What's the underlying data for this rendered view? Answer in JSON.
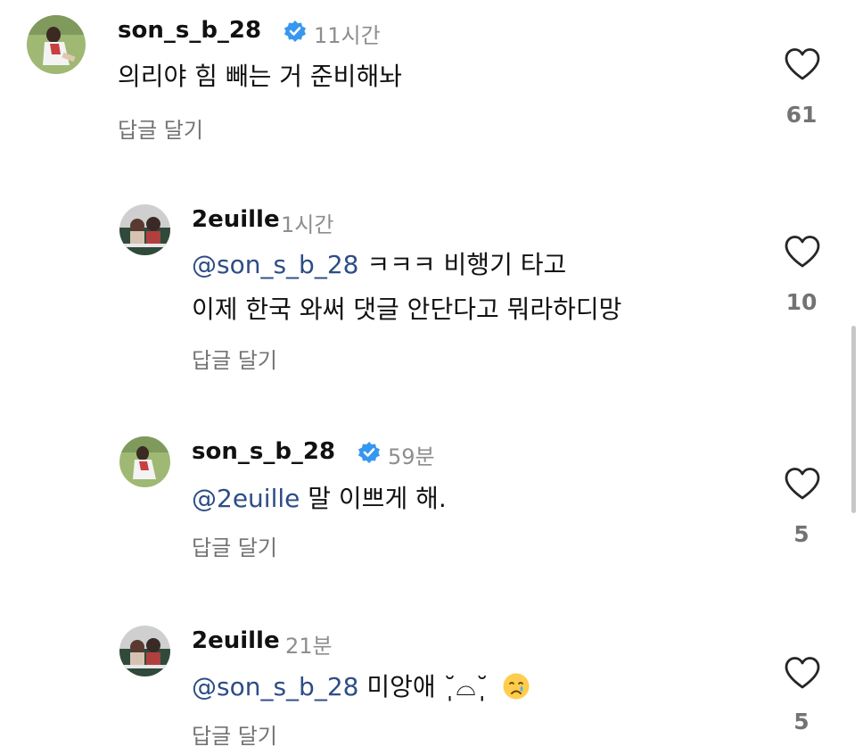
{
  "comments": [
    {
      "username": "son_s_b_28",
      "verified": true,
      "time": "11시간",
      "lines": [
        {
          "mention": "",
          "text": "의리야 힘 빼는 거 준비해놔"
        }
      ],
      "reply_label": "답글 달기",
      "likes": "61"
    },
    {
      "username": "2euille",
      "verified": false,
      "time": "1시간",
      "lines": [
        {
          "mention": "@son_s_b_28",
          "text": " ㅋㅋㅋ 비행기 타고"
        },
        {
          "mention": "",
          "text": "이제 한국 와써 댓글 안단다고 뭐라하디망"
        }
      ],
      "reply_label": "답글 달기",
      "likes": "10"
    },
    {
      "username": "son_s_b_28",
      "verified": true,
      "time": "59분",
      "lines": [
        {
          "mention": "@2euille",
          "text": " 말 이쁘게 해."
        }
      ],
      "reply_label": "답글 달기",
      "likes": "5"
    },
    {
      "username": "2euille",
      "verified": false,
      "time": "21분",
      "lines": [
        {
          "mention": "@son_s_b_28",
          "text": " 미앙애 ˘̩̩̩⌓˘̩̩̩"
        }
      ],
      "emoji": "crying-face",
      "reply_label": "답글 달기",
      "likes": "5"
    }
  ],
  "colors": {
    "mention": "#2d4d86",
    "verified": "#3797f0",
    "secondary": "#8e8e8e"
  }
}
